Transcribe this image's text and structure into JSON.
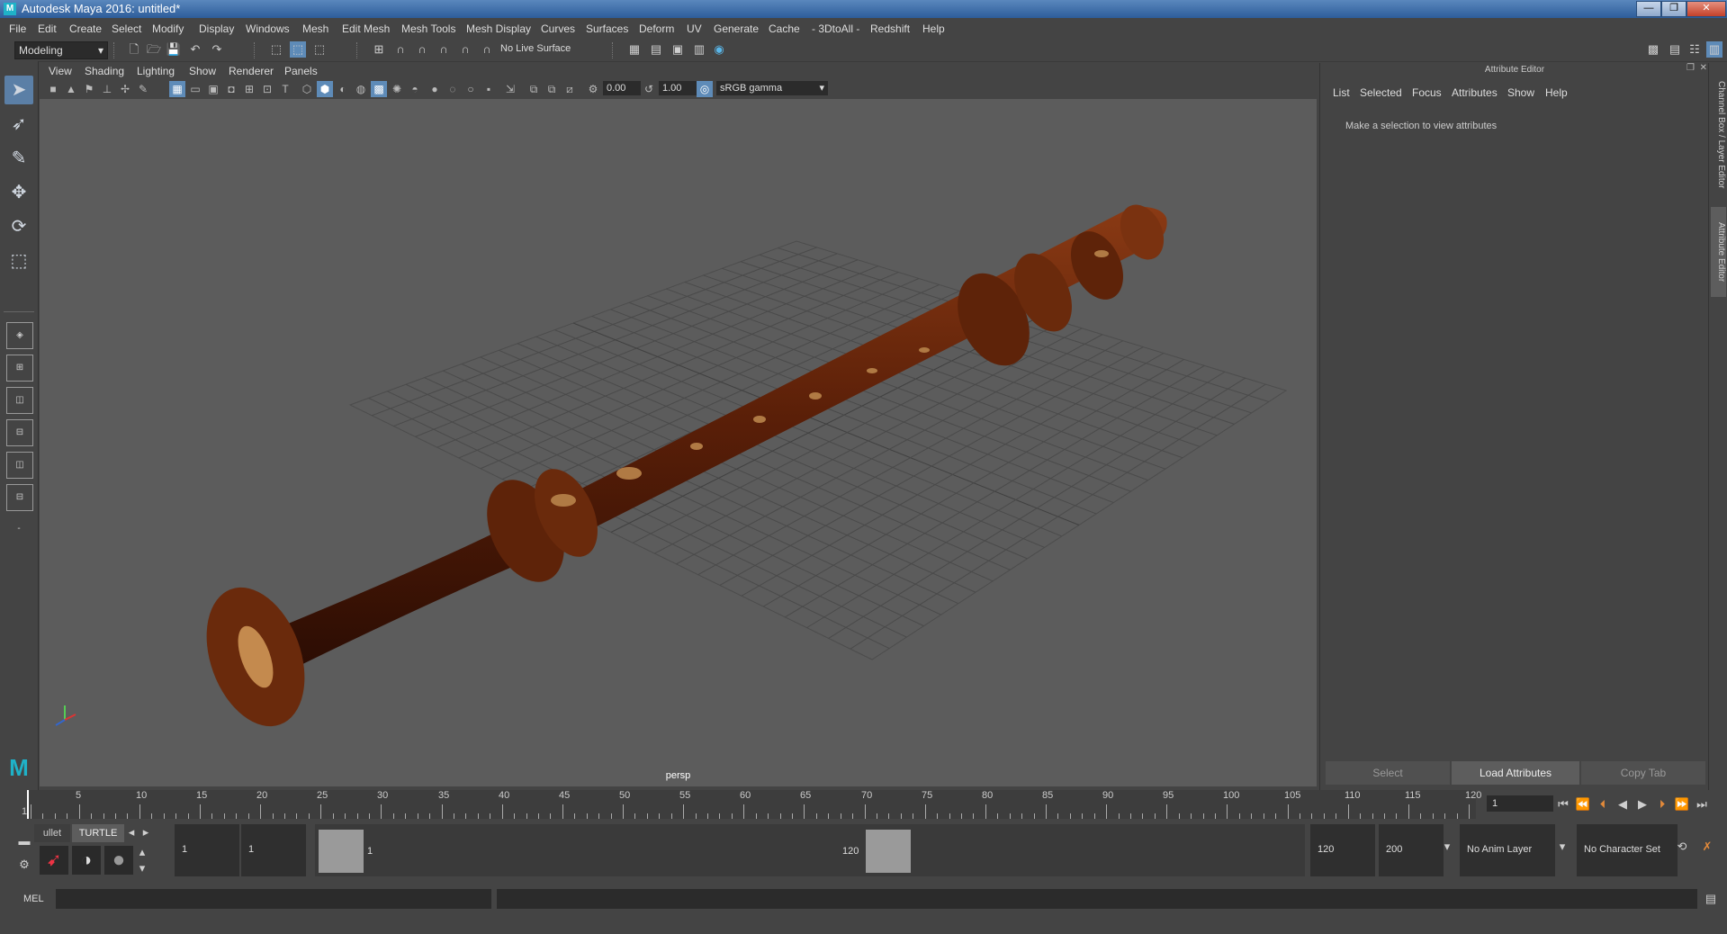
{
  "window": {
    "title": "Autodesk Maya 2016: untitled*",
    "buttons": {
      "minimize": "—",
      "maximize": "❐",
      "close": "✕"
    }
  },
  "menubar": [
    "File",
    "Edit",
    "Create",
    "Select",
    "Modify",
    "Display",
    "Windows",
    "Mesh",
    "Edit Mesh",
    "Mesh Tools",
    "Mesh Display",
    "Curves",
    "Surfaces",
    "Deform",
    "UV",
    "Generate",
    "Cache",
    "- 3DtoAll -",
    "Redshift",
    "Help"
  ],
  "statusline": {
    "mode": "Modeling",
    "live_surface": "No Live Surface"
  },
  "viewport": {
    "menu": [
      "View",
      "Shading",
      "Lighting",
      "Show",
      "Renderer",
      "Panels"
    ],
    "exposure": "0.00",
    "gamma": "1.00",
    "color_space": "sRGB gamma",
    "camera_label": "persp"
  },
  "attribute_editor": {
    "header": "Attribute Editor",
    "menu": [
      "List",
      "Selected",
      "Focus",
      "Attributes",
      "Show",
      "Help"
    ],
    "message": "Make a selection to view attributes",
    "buttons": {
      "select": "Select",
      "load": "Load Attributes",
      "copy": "Copy Tab"
    },
    "side_tabs": {
      "channel_box": "Channel Box / Layer Editor",
      "attribute_editor": "Attribute Editor"
    }
  },
  "timeline": {
    "tick_labels": [
      "1",
      "5",
      "10",
      "15",
      "20",
      "25",
      "30",
      "35",
      "40",
      "45",
      "50",
      "55",
      "60",
      "65",
      "70",
      "75",
      "80",
      "85",
      "90",
      "95",
      "100",
      "105",
      "110",
      "115",
      "120"
    ],
    "current_frame": "1"
  },
  "range": {
    "shelf_tabs": [
      "ullet",
      "TURTLE"
    ],
    "start_time": "1",
    "playback_start": "1",
    "range_start_label": "1",
    "range_end_label": "120",
    "playback_end": "120",
    "end_time": "200",
    "anim_layer": "No Anim Layer",
    "character_set": "No Character Set"
  },
  "command_line": {
    "language": "MEL"
  }
}
